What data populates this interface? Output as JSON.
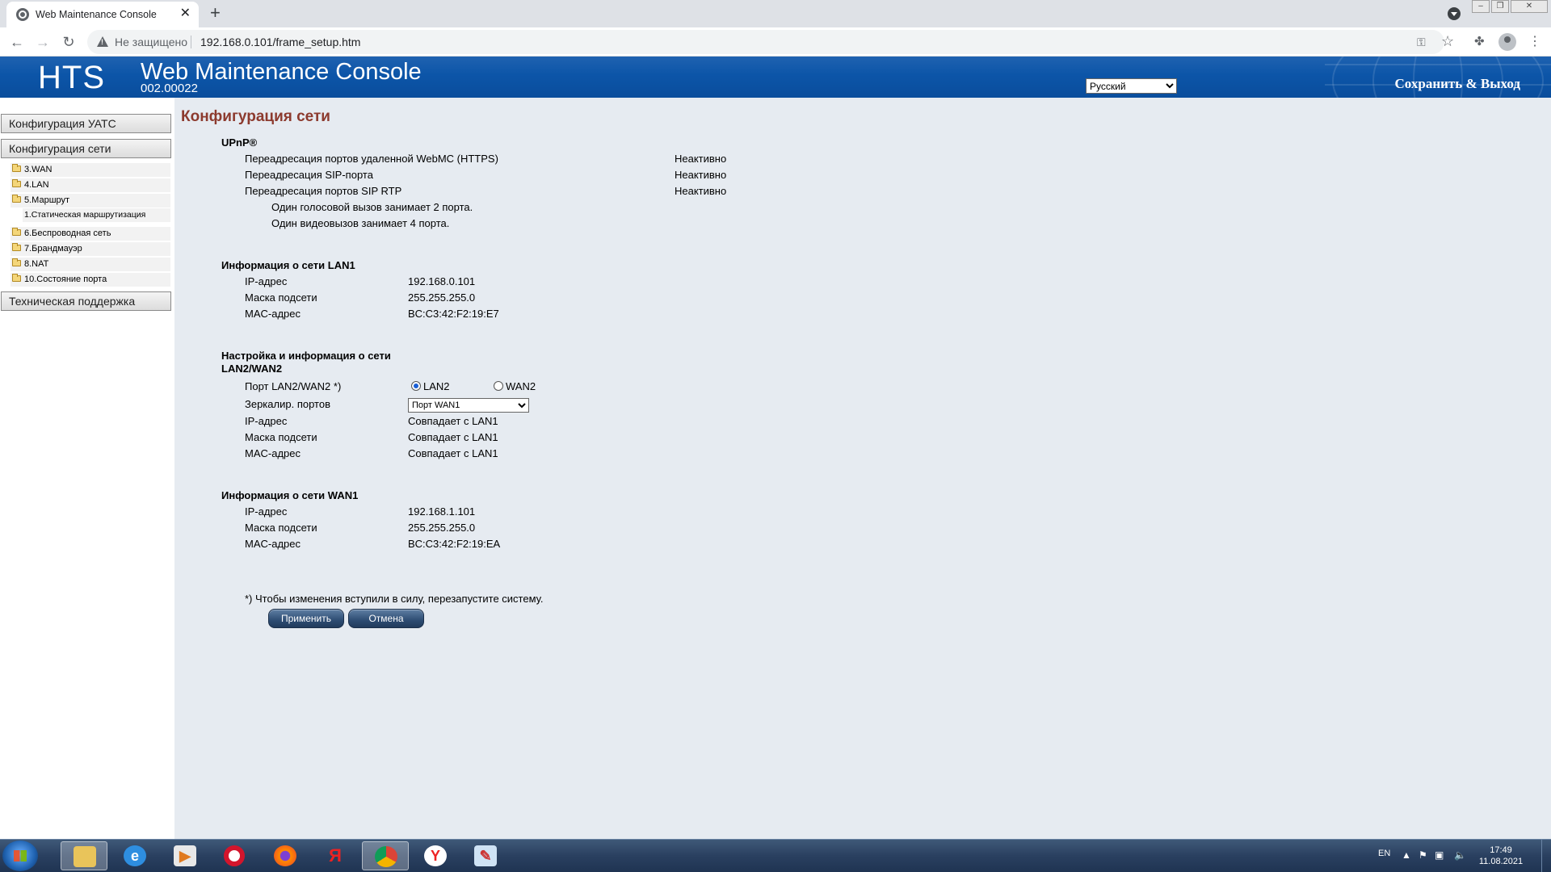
{
  "browser": {
    "tab_title": "Web Maintenance Console",
    "tab_close": "✕",
    "new_tab": "+",
    "security_label": "Не защищено",
    "url": "192.168.0.101/frame_setup.htm"
  },
  "header": {
    "brand": "HTS",
    "title": "Web Maintenance Console",
    "version": "002.00022",
    "language": "Русский",
    "save_exit": "Сохранить & Выход"
  },
  "sidebar": {
    "section_pbx": "Конфигурация УАТС",
    "section_network": "Конфигурация сети",
    "items": [
      {
        "label": "3.WAN"
      },
      {
        "label": "4.LAN"
      },
      {
        "label": "5.Маршрут"
      },
      {
        "label": "6.Беспроводная сеть"
      },
      {
        "label": "7.Брандмауэр"
      },
      {
        "label": "8.NAT"
      },
      {
        "label": "10.Состояние порта"
      }
    ],
    "subitem_static_routing": "1.Статическая маршрутизация",
    "section_support": "Техническая поддержка"
  },
  "main": {
    "page_title": "Конфигурация сети",
    "upnp": {
      "heading": "UPnP®",
      "rows": [
        {
          "label": "Переадресация портов удаленной WebMC (HTTPS)",
          "value": "Неактивно"
        },
        {
          "label": "Переадресация SIP-порта",
          "value": "Неактивно"
        },
        {
          "label": "Переадресация портов SIP RTP",
          "value": "Неактивно"
        }
      ],
      "note_voice": "Один голосовой вызов занимает 2 порта.",
      "note_video": "Один видеовызов занимает 4 порта."
    },
    "lan1": {
      "heading": "Информация о сети LAN1",
      "ip_label": "IP-адрес",
      "ip": "192.168.0.101",
      "mask_label": "Маска подсети",
      "mask": "255.255.255.0",
      "mac_label": "MAC-адрес",
      "mac": "BC:C3:42:F2:19:E7"
    },
    "lan2": {
      "heading_line1": "Настройка и информация о сети",
      "heading_line2": "LAN2/WAN2",
      "port_label": "Порт LAN2/WAN2 *)",
      "radio_lan2": "LAN2",
      "radio_wan2": "WAN2",
      "selected_port": "LAN2",
      "mirror_label": "Зеркалир. портов",
      "mirror_value": "Порт WAN1",
      "ip_label": "IP-адрес",
      "ip": "Совпадает с LAN1",
      "mask_label": "Маска подсети",
      "mask": "Совпадает с LAN1",
      "mac_label": "MAC-адрес",
      "mac": "Совпадает с LAN1"
    },
    "wan1": {
      "heading": "Информация о сети WAN1",
      "ip_label": "IP-адрес",
      "ip": "192.168.1.101",
      "mask_label": "Маска подсети",
      "mask": "255.255.255.0",
      "mac_label": "MAC-адрес",
      "mac": "BC:C3:42:F2:19:EA"
    },
    "restart_note": "*) Чтобы изменения вступили в силу, перезапустите систему.",
    "apply_label": "Применить",
    "cancel_label": "Отмена"
  },
  "taskbar": {
    "language": "EN",
    "time": "17:49",
    "date": "11.08.2021"
  },
  "colors": {
    "header_blue": "#0c55a8",
    "content_bg": "#e6ebf1",
    "page_title": "#8c3a2e",
    "button": "#2e4d73"
  }
}
